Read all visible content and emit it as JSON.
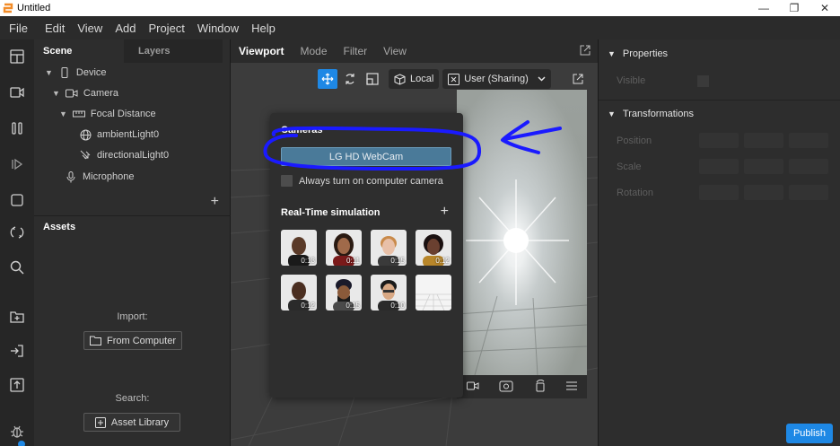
{
  "window": {
    "title": "Untitled",
    "minimize": "—",
    "maximize": "❐",
    "close": "✕"
  },
  "menu": [
    "File",
    "Edit",
    "View",
    "Add",
    "Project",
    "Window",
    "Help"
  ],
  "scene": {
    "tabs": [
      "Scene",
      "Layers"
    ],
    "tree": [
      {
        "label": "Device"
      },
      {
        "label": "Camera"
      },
      {
        "label": "Focal Distance"
      },
      {
        "label": "ambientLight0"
      },
      {
        "label": "directionalLight0"
      },
      {
        "label": "Microphone"
      }
    ],
    "add": "+"
  },
  "assets": {
    "title": "Assets",
    "import_label": "Import:",
    "from_computer": "From Computer",
    "search_label": "Search:",
    "asset_library": "Asset Library"
  },
  "viewport": {
    "tabs": [
      "Viewport",
      "Mode",
      "Filter",
      "View"
    ],
    "local": "Local",
    "user": "User (Sharing)"
  },
  "cameras_popup": {
    "title": "Cameras",
    "webcam": "LG HD WebCam",
    "always_on": "Always turn on computer camera",
    "realtime_title": "Real-Time simulation",
    "add": "+",
    "durations": [
      "0:13",
      "0:11",
      "0:15",
      "0:12",
      "0:12",
      "0:15",
      "0:10"
    ]
  },
  "properties": {
    "title": "Properties",
    "visible": "Visible",
    "transformations": "Transformations",
    "position": "Position",
    "scale": "Scale",
    "rotation": "Rotation"
  },
  "publish": "Publish",
  "colors": {
    "accent": "#1e88e5",
    "annotation": "#1a1aff"
  }
}
